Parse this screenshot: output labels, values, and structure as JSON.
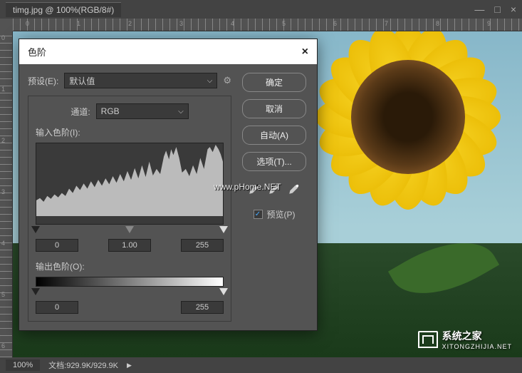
{
  "titlebar": {
    "doc_title": "timg.jpg @ 100%(RGB/8#)"
  },
  "ruler_marks_h": [
    "0",
    "1",
    "2",
    "3",
    "4",
    "5",
    "6",
    "7",
    "8",
    "9"
  ],
  "ruler_marks_v": [
    "0",
    "1",
    "2",
    "3",
    "4",
    "5",
    "6"
  ],
  "dialog": {
    "title": "色阶",
    "preset_label": "预设(E):",
    "preset_value": "默认值",
    "channel_label": "通道:",
    "channel_value": "RGB",
    "input_label": "输入色阶(I):",
    "input_black": "0",
    "input_gamma": "1.00",
    "input_white": "255",
    "output_label": "输出色阶(O):",
    "output_black": "0",
    "output_white": "255",
    "btn_ok": "确定",
    "btn_cancel": "取消",
    "btn_auto": "自动(A)",
    "btn_options": "选项(T)...",
    "preview_label": "预览(P)",
    "preview_checked": true
  },
  "statusbar": {
    "zoom": "100%",
    "doc_info": "文档:929.9K/929.9K"
  },
  "watermarks": {
    "w1": "www.pHome.NET",
    "w2_title": "系统之家",
    "w2_sub": "XITONGZHIJIA.NET"
  }
}
